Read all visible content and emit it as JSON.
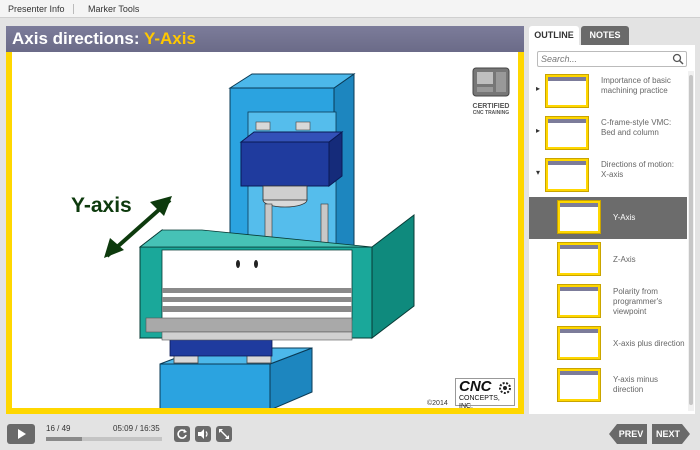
{
  "topbar": {
    "presenter_info": "Presenter Info",
    "marker_tools": "Marker Tools"
  },
  "slide": {
    "title_prefix": "Axis directions: ",
    "title_highlight": "Y-Axis",
    "axis_label": "Y-axis",
    "logo_line1": "CERTIFIED",
    "logo_line2": "CNC TRAINING",
    "brand_line1": "CNC",
    "brand_line2": "CONCEPTS, INC.",
    "copyright": "©2014"
  },
  "panel": {
    "tab_outline": "OUTLINE",
    "tab_notes": "NOTES",
    "search_placeholder": "Search...",
    "items": [
      {
        "label": "Importance of basic machining practice",
        "level": 0,
        "arrow": "▸",
        "selected": false
      },
      {
        "label": "C-frame-style VMC: Bed and column",
        "level": 0,
        "arrow": "▸",
        "selected": false
      },
      {
        "label": "Directions of motion: X-axis",
        "level": 0,
        "arrow": "▾",
        "selected": false
      },
      {
        "label": "Y-Axis",
        "level": 1,
        "arrow": "",
        "selected": true
      },
      {
        "label": "Z-Axis",
        "level": 1,
        "arrow": "",
        "selected": false
      },
      {
        "label": "Polarity from programmer's viewpoint",
        "level": 1,
        "arrow": "",
        "selected": false
      },
      {
        "label": "X-axis plus direction",
        "level": 1,
        "arrow": "",
        "selected": false
      },
      {
        "label": "Y-axis minus direction",
        "level": 1,
        "arrow": "",
        "selected": false
      }
    ]
  },
  "bottombar": {
    "slide_count": "16 / 49",
    "time_readout": "05:09 / 16:35",
    "progress": 0.31,
    "prev_label": "PREV",
    "next_label": "NEXT"
  },
  "colors": {
    "accent_yellow": "#ffd700",
    "title_bar": "#6b6b88",
    "selected_row": "#6c6c6c",
    "machine_blue": "#2ba3e0",
    "machine_teal": "#1aa89a",
    "spindle_navy": "#1f3b9e"
  }
}
